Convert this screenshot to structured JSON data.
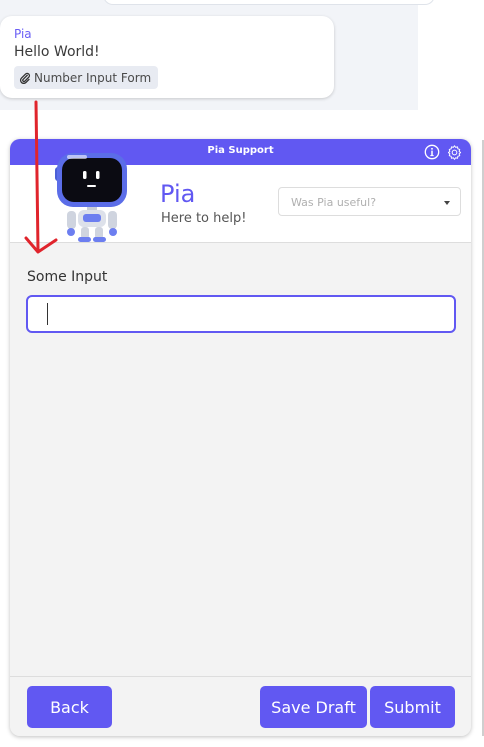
{
  "chat": {
    "sender": "Pia",
    "message": "Hello World!",
    "attachment_label": "Number Input Form",
    "attachment_icon": "paperclip-icon"
  },
  "widget": {
    "title": "Pia Support",
    "info_icon": "info-icon",
    "settings_icon": "gear-icon",
    "bot_name": "Pia",
    "bot_tagline": "Here to help!",
    "feedback": {
      "placeholder": "Was Pia useful?",
      "caret_icon": "caret-down-icon"
    },
    "form": {
      "field_label": "Some Input",
      "field_value": ""
    },
    "footer": {
      "back_label": "Back",
      "save_draft_label": "Save Draft",
      "submit_label": "Submit"
    }
  },
  "colors": {
    "accent": "#6158f2",
    "annotation": "#e0242c",
    "panel_background": "#f3f3f3"
  }
}
